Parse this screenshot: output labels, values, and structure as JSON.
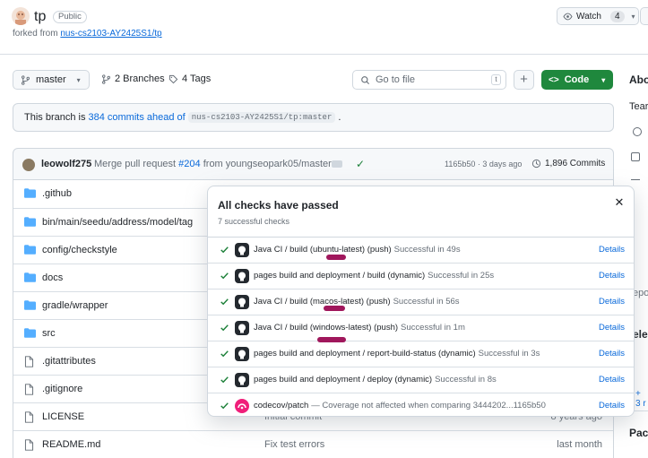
{
  "repo": {
    "name": "tp",
    "visibility": "Public",
    "forked_prefix": "forked from",
    "forked_from": "nus-cs2103-AY2425S1/tp",
    "watch_label": "Watch",
    "watch_count": "4"
  },
  "branch_bar": {
    "branch": "master",
    "branches": "2 Branches",
    "tags": "4 Tags",
    "goto_placeholder": "Go to file",
    "goto_key": "t",
    "code_label": "Code"
  },
  "ahead_banner": {
    "prefix": "This branch is",
    "commits_link": "384 commits ahead of",
    "upstream": "nus-cs2103-AY2425S1/tp:master",
    "suffix": "."
  },
  "latest_commit": {
    "author": "leowolf275",
    "message_prefix": "Merge pull request",
    "pr": "#204",
    "message_suffix": "from youngseopark05/master",
    "meta": "1165b50 · 3 days ago",
    "commit_count": "1,896 Commits"
  },
  "files": [
    {
      "name": ".github",
      "type": "folder",
      "msg": "",
      "date": ""
    },
    {
      "name": "bin/main/seedu/address/model/tag",
      "type": "folder",
      "msg": "",
      "date": ""
    },
    {
      "name": "config/checkstyle",
      "type": "folder",
      "msg": "",
      "date": ""
    },
    {
      "name": "docs",
      "type": "folder",
      "msg": "",
      "date": ""
    },
    {
      "name": "gradle/wrapper",
      "type": "folder",
      "msg": "",
      "date": ""
    },
    {
      "name": "src",
      "type": "folder",
      "msg": "",
      "date": ""
    },
    {
      "name": ".gitattributes",
      "type": "file",
      "msg": "",
      "date": ""
    },
    {
      "name": ".gitignore",
      "type": "file",
      "msg": "",
      "date": ""
    },
    {
      "name": "LICENSE",
      "type": "file",
      "msg": "Initial commit",
      "date": "8 years ago"
    },
    {
      "name": "README.md",
      "type": "file",
      "msg": "Fix test errors",
      "date": "last month"
    }
  ],
  "sidebar": {
    "about": "Abo",
    "team": "Tear",
    "releases": "ele",
    "packages": "Pack",
    "more": "+ 3 r",
    "repo": "epo"
  },
  "checks_popover": {
    "title": "All checks have passed",
    "subtitle": "7 successful checks",
    "details_label": "Details",
    "checks": [
      {
        "name": "Java CI / build (ubuntu-latest) (push)",
        "status": "Successful in 49s",
        "app": "github"
      },
      {
        "name": "pages build and deployment / build (dynamic)",
        "status": "Successful in 25s",
        "app": "github"
      },
      {
        "name": "Java CI / build (macos-latest) (push)",
        "status": "Successful in 56s",
        "app": "github"
      },
      {
        "name": "Java CI / build (windows-latest) (push)",
        "status": "Successful in 1m",
        "app": "github"
      },
      {
        "name": "pages build and deployment / report-build-status (dynamic)",
        "status": "Successful in 3s",
        "app": "github"
      },
      {
        "name": "pages build and deployment / deploy (dynamic)",
        "status": "Successful in 8s",
        "app": "github"
      },
      {
        "name": "codecov/patch",
        "status": "— Coverage not affected when comparing 3444202...1165b50",
        "app": "codecov"
      }
    ]
  }
}
